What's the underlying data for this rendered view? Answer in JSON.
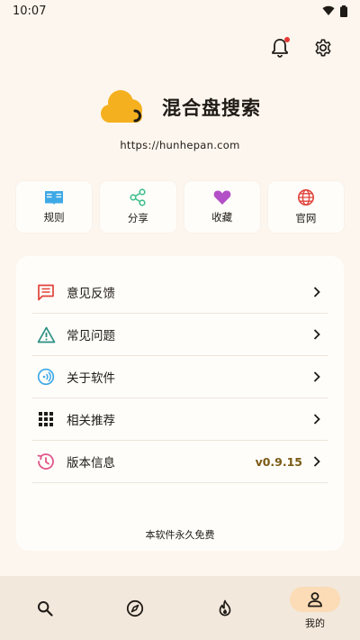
{
  "status": {
    "time": "10:07"
  },
  "brand": {
    "name": "混合盘搜索",
    "url": "https://hunhepan.com"
  },
  "quick_actions": [
    {
      "label": "规则",
      "icon": "book-icon",
      "color": "#3fa9e6"
    },
    {
      "label": "分享",
      "icon": "share-icon",
      "color": "#3fbf8a"
    },
    {
      "label": "收藏",
      "icon": "heart-icon",
      "color": "#b34fc7"
    },
    {
      "label": "官网",
      "icon": "globe-icon",
      "color": "#e0433a"
    }
  ],
  "menu": [
    {
      "label": "意见反馈",
      "icon": "feedback-icon",
      "color": "#e0433a"
    },
    {
      "label": "常见问题",
      "icon": "warning-icon",
      "color": "#2a8f82"
    },
    {
      "label": "关于软件",
      "icon": "about-icon",
      "color": "#3fa9e6"
    },
    {
      "label": "相关推荐",
      "icon": "grid-icon",
      "color": "#1f1b16"
    },
    {
      "label": "版本信息",
      "icon": "history-icon",
      "color": "#e0568a",
      "value": "v0.9.15"
    }
  ],
  "footer_note": "本软件永久免费",
  "nav": [
    {
      "icon": "search-icon"
    },
    {
      "icon": "compass-icon"
    },
    {
      "icon": "fire-icon"
    },
    {
      "icon": "person-icon",
      "label": "我的",
      "active": true
    }
  ],
  "colors": {
    "background": "#fdf6ee",
    "card": "#fffdfa",
    "accent": "#f5b01f",
    "active_pill": "#fbdcb6",
    "version": "#7a5a14"
  }
}
